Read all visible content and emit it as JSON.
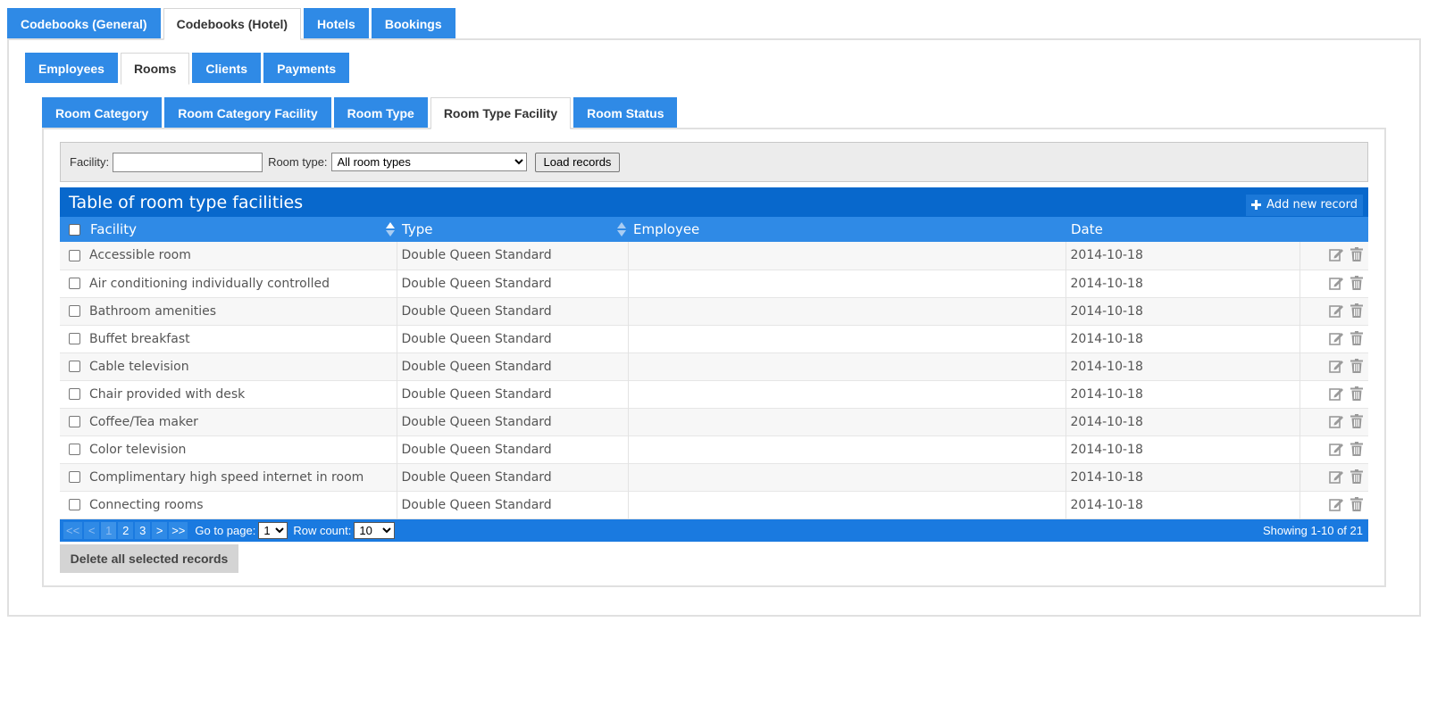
{
  "main_tabs": [
    {
      "label": "Codebooks (General)",
      "active": false
    },
    {
      "label": "Codebooks (Hotel)",
      "active": true
    },
    {
      "label": "Hotels",
      "active": false
    },
    {
      "label": "Bookings",
      "active": false
    }
  ],
  "sub_tabs": [
    {
      "label": "Employees",
      "active": false
    },
    {
      "label": "Rooms",
      "active": true
    },
    {
      "label": "Clients",
      "active": false
    },
    {
      "label": "Payments",
      "active": false
    }
  ],
  "room_tabs": [
    {
      "label": "Room Category",
      "active": false
    },
    {
      "label": "Room Category Facility",
      "active": false
    },
    {
      "label": "Room Type",
      "active": false
    },
    {
      "label": "Room Type Facility",
      "active": true
    },
    {
      "label": "Room Status",
      "active": false
    }
  ],
  "filter": {
    "facility_label": "Facility:",
    "facility_value": "",
    "room_type_label": "Room type:",
    "room_type_selected": "All room types",
    "load_label": "Load records"
  },
  "table": {
    "title": "Table of room type facilities",
    "add_label": "Add new record",
    "columns": [
      "Facility",
      "Type",
      "Employee",
      "Date"
    ],
    "rows": [
      {
        "facility": "Accessible room",
        "type": "Double Queen Standard",
        "employee": "",
        "date": "2014-10-18"
      },
      {
        "facility": "Air conditioning individually controlled",
        "type": "Double Queen Standard",
        "employee": "",
        "date": "2014-10-18"
      },
      {
        "facility": "Bathroom amenities",
        "type": "Double Queen Standard",
        "employee": "",
        "date": "2014-10-18"
      },
      {
        "facility": "Buffet breakfast",
        "type": "Double Queen Standard",
        "employee": "",
        "date": "2014-10-18"
      },
      {
        "facility": "Cable television",
        "type": "Double Queen Standard",
        "employee": "",
        "date": "2014-10-18"
      },
      {
        "facility": "Chair provided with desk",
        "type": "Double Queen Standard",
        "employee": "",
        "date": "2014-10-18"
      },
      {
        "facility": "Coffee/Tea maker",
        "type": "Double Queen Standard",
        "employee": "",
        "date": "2014-10-18"
      },
      {
        "facility": "Color television",
        "type": "Double Queen Standard",
        "employee": "",
        "date": "2014-10-18"
      },
      {
        "facility": "Complimentary high speed internet in room",
        "type": "Double Queen Standard",
        "employee": "",
        "date": "2014-10-18"
      },
      {
        "facility": "Connecting rooms",
        "type": "Double Queen Standard",
        "employee": "",
        "date": "2014-10-18"
      }
    ]
  },
  "pager": {
    "first": "<<",
    "prev": "<",
    "pages": [
      "1",
      "2",
      "3"
    ],
    "current_page": "1",
    "next": ">",
    "last": ">>",
    "goto_label": "Go to page:",
    "goto_value": "1",
    "rowcount_label": "Row count:",
    "rowcount_value": "10",
    "showing": "Showing 1-10 of 21"
  },
  "delete_label": "Delete all selected records",
  "colors": {
    "tab_blue": "#2f8ae6",
    "title_blue": "#0868cc",
    "pager_blue": "#1a7ae0"
  },
  "icons": {
    "add": "plus-icon",
    "edit": "edit-icon",
    "delete": "trash-icon",
    "sort": "sort-arrows-icon"
  }
}
